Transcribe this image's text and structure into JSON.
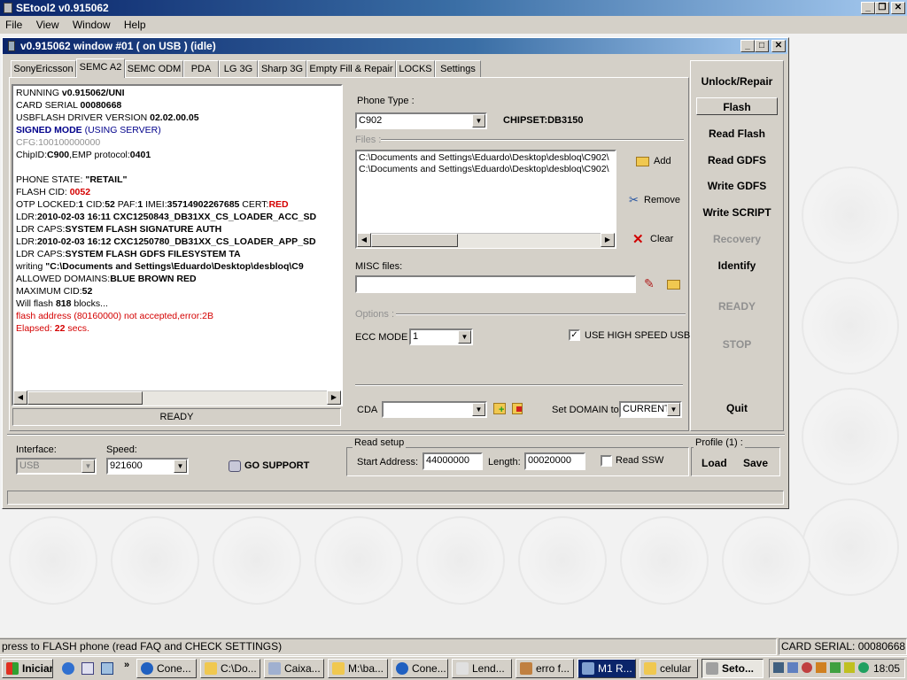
{
  "app": {
    "title": "SEtool2 v0.915062"
  },
  "menu": [
    "File",
    "View",
    "Window",
    "Help"
  ],
  "child": {
    "title": "v0.915062 window #01 ( on USB ) (idle)"
  },
  "tabs": [
    "SonyEricsson",
    "SEMC A2",
    "SEMC ODM",
    "PDA",
    "LG 3G",
    "Sharp 3G",
    "Empty Fill & Repair",
    "LOCKS",
    "Settings"
  ],
  "active_tab": "SEMC A2",
  "log": {
    "l1a": "RUNNING ",
    "l1b": "v0.915062/UNI",
    "l2a": "CARD SERIAL ",
    "l2b": "00080668",
    "l3a": "USBFLASH DRIVER VERSION ",
    "l3b": "02.02.00.05",
    "l4a": "SIGNED MODE",
    "l4b": " (USING SERVER)",
    "l5": "CFG:100100000000",
    "l6a": "ChipID:",
    "l6b": "C900",
    "l6c": ",EMP protocol:",
    "l6d": "0401",
    "l7a": "PHONE STATE: ",
    "l7b": "\"RETAIL\"",
    "l8a": "FLASH CID: ",
    "l8b": "0052",
    "l9a": "OTP LOCKED:",
    "l9b": "1",
    "l9c": " CID:",
    "l9d": "52",
    "l9e": " PAF:",
    "l9f": "1",
    "l9g": " IMEI:",
    "l9h": "35714902267685",
    "l9i": " CERT:",
    "l9j": "RED",
    "l10a": "LDR:",
    "l10b": "2010-02-03 16:11 CXC1250843_DB31XX_CS_LOADER_ACC_SD",
    "l11a": "LDR CAPS:",
    "l11b": "SYSTEM FLASH SIGNATURE AUTH",
    "l12a": "LDR:",
    "l12b": "2010-02-03 16:12 CXC1250780_DB31XX_CS_LOADER_APP_SD",
    "l13a": "LDR CAPS:",
    "l13b": "SYSTEM FLASH GDFS FILESYSTEM TA",
    "l14a": "writing ",
    "l14b": "\"C:\\Documents and Settings\\Eduardo\\Desktop\\desbloq\\C9",
    "l15a": "ALLOWED DOMAINS:",
    "l15b": "BLUE BROWN RED",
    "l16a": "MAXIMUM CID:",
    "l16b": "52",
    "l17a": "Will flash ",
    "l17b": "818",
    "l17c": " blocks...",
    "l18": "flash address (80160000) not accepted,error:2B",
    "l19a": "Elapsed: ",
    "l19b": "22",
    "l19c": " secs."
  },
  "log_status": "READY",
  "phone_type": {
    "label": "Phone Type :",
    "value": "C902",
    "chipset": "CHIPSET:DB3150"
  },
  "files": {
    "label": "Files :",
    "items": [
      "C:\\Documents and Settings\\Eduardo\\Desktop\\desbloq\\C902\\",
      "C:\\Documents and Settings\\Eduardo\\Desktop\\desbloq\\C902\\"
    ],
    "add": "Add",
    "remove": "Remove",
    "clear": "Clear"
  },
  "misc": {
    "label": "MISC files:",
    "value": ""
  },
  "options": {
    "label": "Options :",
    "ecc_label": "ECC MODE",
    "ecc_value": "1",
    "high_speed_label": "USE HIGH SPEED USB",
    "high_speed_checked": true
  },
  "cda": {
    "label": "CDA",
    "value": "",
    "domain_label": "Set DOMAIN to",
    "domain_value": "CURRENT"
  },
  "right_buttons": [
    "Unlock/Repair",
    "Flash",
    "Read Flash",
    "Read GDFS",
    "Write GDFS",
    "Write SCRIPT",
    "Recovery",
    "Identify",
    "READY",
    "STOP",
    "Quit"
  ],
  "bottom": {
    "interface_label": "Interface:",
    "interface_value": "USB",
    "speed_label": "Speed:",
    "speed_value": "921600",
    "go_support": "GO SUPPORT",
    "read_setup_label": "Read setup",
    "start_label": "Start Address:",
    "start_value": "44000000",
    "length_label": "Length:",
    "length_value": "00020000",
    "read_ssw_label": "Read SSW",
    "profile_label": "Profile (1) :",
    "load": "Load",
    "save": "Save"
  },
  "statusbar": {
    "left": "press to FLASH phone  (read FAQ and CHECK SETTINGS)",
    "right": "CARD SERIAL: 00080668"
  },
  "taskbar": {
    "start": "Iniciar",
    "items": [
      "Cone...",
      "C:\\Do...",
      "Caixa...",
      "M:\\ba...",
      "Cone...",
      "Lend...",
      "erro f...",
      "M1 R...",
      "celular",
      "Seto..."
    ],
    "clock": "18:05"
  },
  "colors": {
    "title_blue": "#0a246a",
    "face": "#d4d0c8",
    "log_red": "#d40000",
    "log_blue": "#00008b"
  }
}
